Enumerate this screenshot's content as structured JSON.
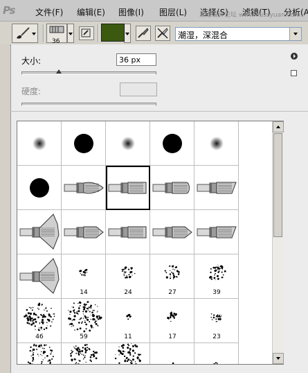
{
  "app": {
    "logo": "Ps"
  },
  "menu": {
    "items": [
      "文件(F)",
      "编辑(E)",
      "图像(I)",
      "图层(L)",
      "选择(S)",
      "滤镜(T)",
      "分析(A)"
    ],
    "watermark": "思缘设计论坛 www.missyuan.com"
  },
  "options": {
    "brush_size": "36",
    "foreground_color": "#3b5a0f",
    "blend_mode": "潮湿，深混合"
  },
  "panel": {
    "size_label": "大小:",
    "size_value": "36 px",
    "size_slider_fraction": 0.28,
    "hardness_label": "硬度:",
    "hardness_value": ""
  },
  "brushes": [
    {
      "kind": "soft",
      "r": 10,
      "label": ""
    },
    {
      "kind": "hard",
      "r": 14,
      "label": ""
    },
    {
      "kind": "soft",
      "r": 10,
      "label": ""
    },
    {
      "kind": "hard",
      "r": 14,
      "label": ""
    },
    {
      "kind": "soft",
      "r": 10,
      "label": ""
    },
    {
      "kind": "hard",
      "r": 14,
      "label": ""
    },
    {
      "kind": "bristle-round",
      "label": ""
    },
    {
      "kind": "bristle-flat",
      "label": "",
      "selected": true
    },
    {
      "kind": "bristle-blunt",
      "label": ""
    },
    {
      "kind": "bristle-angle",
      "label": ""
    },
    {
      "kind": "bristle-fan",
      "label": ""
    },
    {
      "kind": "bristle-point",
      "label": ""
    },
    {
      "kind": "bristle-flat",
      "label": ""
    },
    {
      "kind": "bristle-point",
      "label": ""
    },
    {
      "kind": "bristle-angle",
      "label": ""
    },
    {
      "kind": "bristle-fan",
      "label": ""
    },
    {
      "kind": "spatter",
      "n": 14,
      "spread": 6,
      "label": "14"
    },
    {
      "kind": "spatter",
      "n": 26,
      "spread": 10,
      "label": "24"
    },
    {
      "kind": "spatter",
      "n": 30,
      "spread": 11,
      "label": "27"
    },
    {
      "kind": "spatter",
      "n": 40,
      "spread": 13,
      "label": "39"
    },
    {
      "kind": "spatter",
      "n": 90,
      "spread": 22,
      "label": "46"
    },
    {
      "kind": "spatter",
      "n": 120,
      "spread": 26,
      "label": "59"
    },
    {
      "kind": "spatter",
      "n": 8,
      "spread": 4,
      "label": "11"
    },
    {
      "kind": "spatter",
      "n": 18,
      "spread": 8,
      "label": "17"
    },
    {
      "kind": "spatter",
      "n": 24,
      "spread": 9,
      "label": "23"
    },
    {
      "kind": "dense",
      "n": 70,
      "spread": 20,
      "label": ""
    },
    {
      "kind": "dense",
      "n": 70,
      "spread": 20,
      "label": ""
    },
    {
      "kind": "dense",
      "n": 70,
      "spread": 20,
      "label": ""
    },
    {
      "kind": "spatter",
      "n": 6,
      "spread": 4,
      "label": ""
    },
    {
      "kind": "spatter",
      "n": 10,
      "spread": 5,
      "label": ""
    }
  ]
}
